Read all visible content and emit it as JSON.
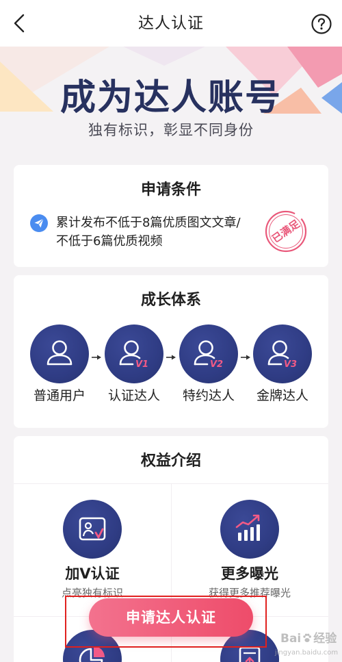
{
  "nav": {
    "title": "达人认证",
    "back_icon": "chevron-left-icon",
    "help_icon": "question-circle-icon"
  },
  "hero": {
    "title": "成为达人账号",
    "subtitle": "独有标识，彰显不同身份"
  },
  "conditions": {
    "title": "申请条件",
    "icon": "paper-plane-icon",
    "lines": [
      "累计发布不低于8篇优质图文文章/",
      "不低于6篇优质视频"
    ],
    "stamp": "已满足"
  },
  "growth": {
    "title": "成长体系",
    "levels": [
      {
        "label": "普通用户",
        "icon": "user-icon"
      },
      {
        "label": "认证达人",
        "icon": "user-v-icon",
        "badge": "V1"
      },
      {
        "label": "特约达人",
        "icon": "user-v-icon",
        "badge": "V2"
      },
      {
        "label": "金牌达人",
        "icon": "user-v-icon",
        "badge": "V3"
      }
    ]
  },
  "benefits": {
    "title": "权益介绍",
    "items": [
      {
        "title": "加V认证",
        "desc": "点亮独有标识",
        "icon": "picture-frame-icon"
      },
      {
        "title": "更多曝光",
        "desc": "获得更多推荐曝光",
        "icon": "bar-chart-icon"
      },
      {
        "icon": "pie-chart-icon"
      },
      {
        "icon": "document-upload-icon"
      }
    ]
  },
  "apply_button": {
    "label": "申请达人认证"
  },
  "watermark": {
    "brand": "Bai",
    "product": "经验",
    "url": "jingyan.baidu.com"
  },
  "colors": {
    "page_bg": "#f4f2f4",
    "navy": "#2f3c84",
    "pink_accent": "#f25a86",
    "button_start": "#f3728e",
    "button_end": "#ee4c6a",
    "stamp": "#e9587a",
    "icon_blue": "#4a8cf0",
    "annotation": "#e0201e"
  }
}
